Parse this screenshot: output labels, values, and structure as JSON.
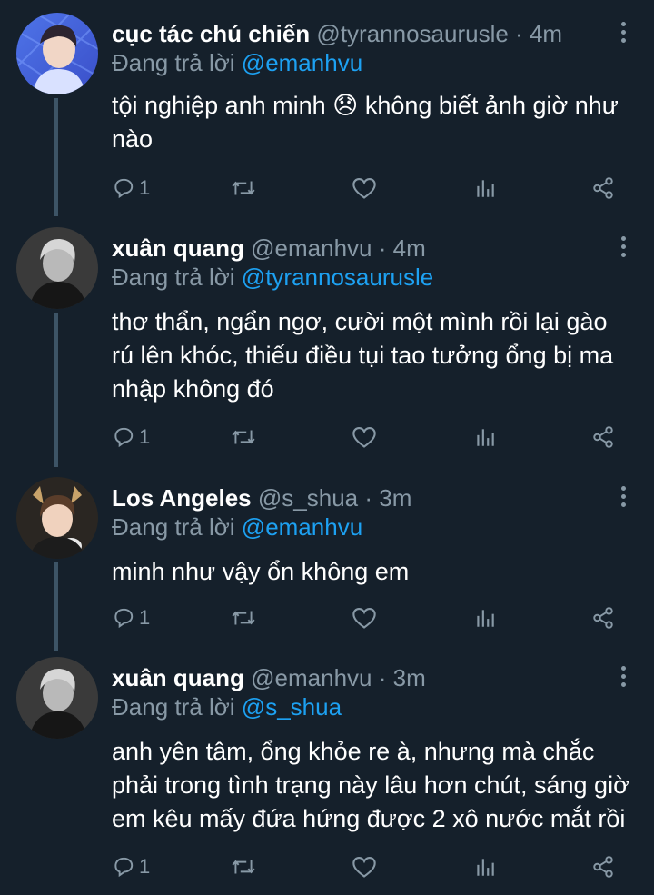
{
  "tweets": [
    {
      "name": "cục tác chú chiến",
      "handle": "@tyrannosaurusle",
      "sep": "·",
      "time": "4m",
      "replying_prefix": "Đang trả lời",
      "replying_to": "@emanhvu",
      "text": "tội nghiệp anh minh 😞 không biết ảnh giờ như nào",
      "reply_count": "1",
      "retweet_count": "",
      "like_count": ""
    },
    {
      "name": "xuân quang",
      "handle": "@emanhvu",
      "sep": "·",
      "time": "4m",
      "replying_prefix": "Đang trả lời",
      "replying_to": "@tyrannosaurusle",
      "text": "thơ thẩn, ngẩn ngơ, cười một mình rồi lại gào rú lên khóc, thiếu điều tụi tao tưởng ổng bị ma nhập không đó",
      "reply_count": "1",
      "retweet_count": "",
      "like_count": ""
    },
    {
      "name": "Los Angeles",
      "handle": "@s_shua",
      "sep": "·",
      "time": "3m",
      "replying_prefix": "Đang trả lời",
      "replying_to": "@emanhvu",
      "text": "minh như vậy ổn không em",
      "reply_count": "1",
      "retweet_count": "",
      "like_count": ""
    },
    {
      "name": "xuân quang",
      "handle": "@emanhvu",
      "sep": "·",
      "time": "3m",
      "replying_prefix": "Đang trả lời",
      "replying_to": "@s_shua",
      "text": "anh yên tâm, ổng khỏe re à, nhưng mà chắc phải trong tình trạng này lâu hơn chút, sáng giờ em kêu mấy đứa hứng được 2 xô nước mắt rồi",
      "reply_count": "1",
      "retweet_count": "",
      "like_count": ""
    }
  ],
  "icons": {
    "reply": "reply-icon",
    "retweet": "retweet-icon",
    "like": "heart-icon",
    "analytics": "analytics-icon",
    "share": "share-icon",
    "more": "more-vertical-icon"
  },
  "colors": {
    "background": "#15202b",
    "secondary_text": "#8899a6",
    "link": "#1da1f2",
    "thread_line": "#3d5466"
  }
}
